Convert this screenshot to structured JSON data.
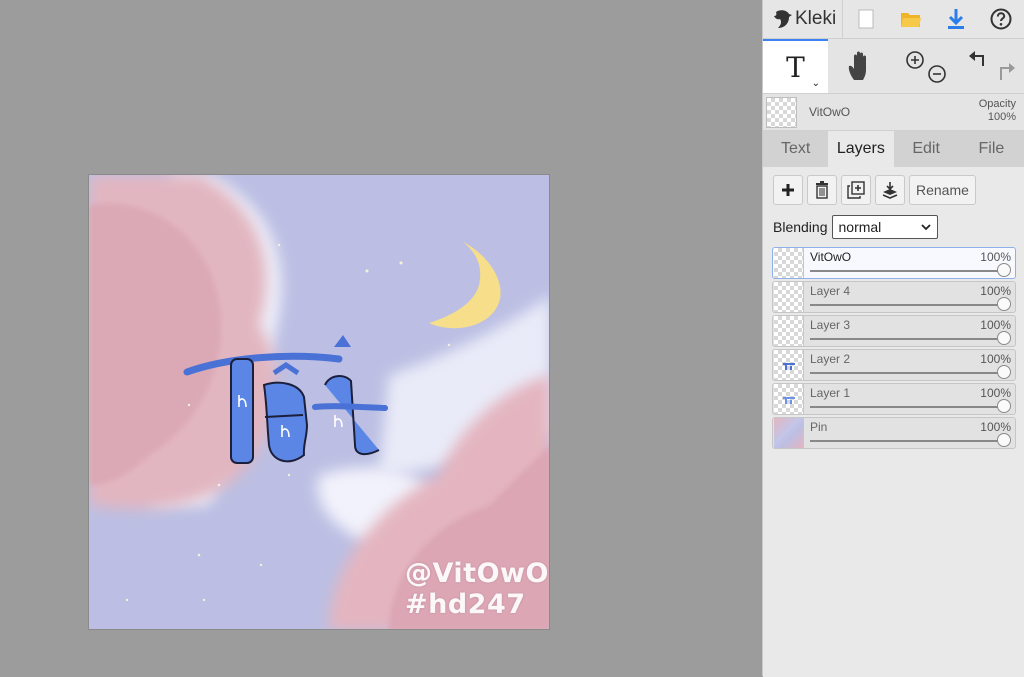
{
  "app": {
    "title": "Kleki"
  },
  "canvas": {
    "watermark_line1": "@VitOwO",
    "watermark_line2": "#hd247"
  },
  "toolbar": {
    "current_tool": "T"
  },
  "layer_strip": {
    "name": "VitOwO",
    "opacity_label": "Opacity",
    "opacity_value": "100%"
  },
  "tabs": [
    {
      "label": "Text"
    },
    {
      "label": "Layers"
    },
    {
      "label": "Edit"
    },
    {
      "label": "File"
    }
  ],
  "layers_panel": {
    "rename_label": "Rename",
    "blending_label": "Blending",
    "blending_value": "normal",
    "layers": [
      {
        "name": "VitOwO",
        "opacity": "100%"
      },
      {
        "name": "Layer 4",
        "opacity": "100%"
      },
      {
        "name": "Layer 3",
        "opacity": "100%"
      },
      {
        "name": "Layer 2",
        "opacity": "100%"
      },
      {
        "name": "Layer 1",
        "opacity": "100%"
      },
      {
        "name": "Pin",
        "opacity": "100%"
      }
    ]
  },
  "colors": {
    "accent": "#3b82f6",
    "workspace": "#9c9c9c",
    "panel": "#dcdcdc"
  }
}
